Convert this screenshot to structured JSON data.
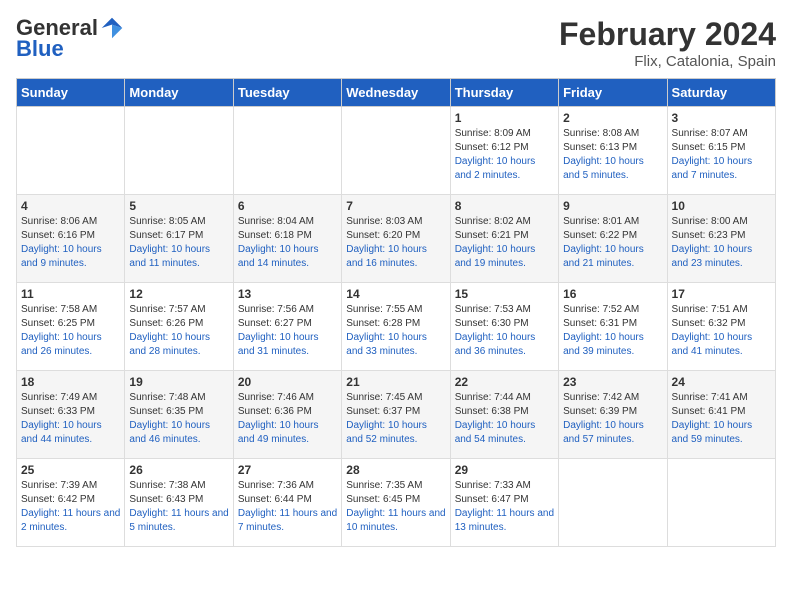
{
  "header": {
    "logo_line1": "General",
    "logo_line2": "Blue",
    "title": "February 2024",
    "subtitle": "Flix, Catalonia, Spain"
  },
  "weekdays": [
    "Sunday",
    "Monday",
    "Tuesday",
    "Wednesday",
    "Thursday",
    "Friday",
    "Saturday"
  ],
  "weeks": [
    [
      {
        "day": "",
        "sunrise": "",
        "sunset": "",
        "daylight": ""
      },
      {
        "day": "",
        "sunrise": "",
        "sunset": "",
        "daylight": ""
      },
      {
        "day": "",
        "sunrise": "",
        "sunset": "",
        "daylight": ""
      },
      {
        "day": "",
        "sunrise": "",
        "sunset": "",
        "daylight": ""
      },
      {
        "day": "1",
        "sunrise": "8:09 AM",
        "sunset": "6:12 PM",
        "daylight": "10 hours and 2 minutes."
      },
      {
        "day": "2",
        "sunrise": "8:08 AM",
        "sunset": "6:13 PM",
        "daylight": "10 hours and 5 minutes."
      },
      {
        "day": "3",
        "sunrise": "8:07 AM",
        "sunset": "6:15 PM",
        "daylight": "10 hours and 7 minutes."
      }
    ],
    [
      {
        "day": "4",
        "sunrise": "8:06 AM",
        "sunset": "6:16 PM",
        "daylight": "10 hours and 9 minutes."
      },
      {
        "day": "5",
        "sunrise": "8:05 AM",
        "sunset": "6:17 PM",
        "daylight": "10 hours and 11 minutes."
      },
      {
        "day": "6",
        "sunrise": "8:04 AM",
        "sunset": "6:18 PM",
        "daylight": "10 hours and 14 minutes."
      },
      {
        "day": "7",
        "sunrise": "8:03 AM",
        "sunset": "6:20 PM",
        "daylight": "10 hours and 16 minutes."
      },
      {
        "day": "8",
        "sunrise": "8:02 AM",
        "sunset": "6:21 PM",
        "daylight": "10 hours and 19 minutes."
      },
      {
        "day": "9",
        "sunrise": "8:01 AM",
        "sunset": "6:22 PM",
        "daylight": "10 hours and 21 minutes."
      },
      {
        "day": "10",
        "sunrise": "8:00 AM",
        "sunset": "6:23 PM",
        "daylight": "10 hours and 23 minutes."
      }
    ],
    [
      {
        "day": "11",
        "sunrise": "7:58 AM",
        "sunset": "6:25 PM",
        "daylight": "10 hours and 26 minutes."
      },
      {
        "day": "12",
        "sunrise": "7:57 AM",
        "sunset": "6:26 PM",
        "daylight": "10 hours and 28 minutes."
      },
      {
        "day": "13",
        "sunrise": "7:56 AM",
        "sunset": "6:27 PM",
        "daylight": "10 hours and 31 minutes."
      },
      {
        "day": "14",
        "sunrise": "7:55 AM",
        "sunset": "6:28 PM",
        "daylight": "10 hours and 33 minutes."
      },
      {
        "day": "15",
        "sunrise": "7:53 AM",
        "sunset": "6:30 PM",
        "daylight": "10 hours and 36 minutes."
      },
      {
        "day": "16",
        "sunrise": "7:52 AM",
        "sunset": "6:31 PM",
        "daylight": "10 hours and 39 minutes."
      },
      {
        "day": "17",
        "sunrise": "7:51 AM",
        "sunset": "6:32 PM",
        "daylight": "10 hours and 41 minutes."
      }
    ],
    [
      {
        "day": "18",
        "sunrise": "7:49 AM",
        "sunset": "6:33 PM",
        "daylight": "10 hours and 44 minutes."
      },
      {
        "day": "19",
        "sunrise": "7:48 AM",
        "sunset": "6:35 PM",
        "daylight": "10 hours and 46 minutes."
      },
      {
        "day": "20",
        "sunrise": "7:46 AM",
        "sunset": "6:36 PM",
        "daylight": "10 hours and 49 minutes."
      },
      {
        "day": "21",
        "sunrise": "7:45 AM",
        "sunset": "6:37 PM",
        "daylight": "10 hours and 52 minutes."
      },
      {
        "day": "22",
        "sunrise": "7:44 AM",
        "sunset": "6:38 PM",
        "daylight": "10 hours and 54 minutes."
      },
      {
        "day": "23",
        "sunrise": "7:42 AM",
        "sunset": "6:39 PM",
        "daylight": "10 hours and 57 minutes."
      },
      {
        "day": "24",
        "sunrise": "7:41 AM",
        "sunset": "6:41 PM",
        "daylight": "10 hours and 59 minutes."
      }
    ],
    [
      {
        "day": "25",
        "sunrise": "7:39 AM",
        "sunset": "6:42 PM",
        "daylight": "11 hours and 2 minutes."
      },
      {
        "day": "26",
        "sunrise": "7:38 AM",
        "sunset": "6:43 PM",
        "daylight": "11 hours and 5 minutes."
      },
      {
        "day": "27",
        "sunrise": "7:36 AM",
        "sunset": "6:44 PM",
        "daylight": "11 hours and 7 minutes."
      },
      {
        "day": "28",
        "sunrise": "7:35 AM",
        "sunset": "6:45 PM",
        "daylight": "11 hours and 10 minutes."
      },
      {
        "day": "29",
        "sunrise": "7:33 AM",
        "sunset": "6:47 PM",
        "daylight": "11 hours and 13 minutes."
      },
      {
        "day": "",
        "sunrise": "",
        "sunset": "",
        "daylight": ""
      },
      {
        "day": "",
        "sunrise": "",
        "sunset": "",
        "daylight": ""
      }
    ]
  ],
  "labels": {
    "sunrise": "Sunrise:",
    "sunset": "Sunset:",
    "daylight": "Daylight:"
  }
}
